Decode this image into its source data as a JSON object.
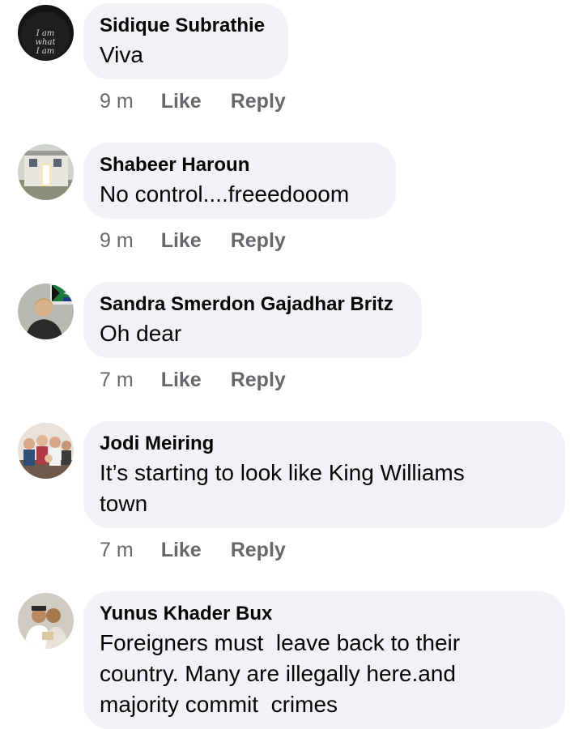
{
  "comments": [
    {
      "author": "Sidique Subrathie",
      "text": "Viva",
      "time": "9 m",
      "like_label": "Like",
      "reply_label": "Reply",
      "avatar": {
        "icon": "profile-photo-text-i-am-what-i-am",
        "caption": "I am what I am"
      }
    },
    {
      "author": "Shabeer Haroun",
      "text": "No control....freeedooom",
      "time": "9 m",
      "like_label": "Like",
      "reply_label": "Reply",
      "avatar": {
        "icon": "profile-photo-house"
      }
    },
    {
      "author": "Sandra Smerdon Gajadhar Britz",
      "text": "Oh dear",
      "time": "7 m",
      "like_label": "Like",
      "reply_label": "Reply",
      "avatar": {
        "icon": "profile-photo-woman-with-sa-flag"
      }
    },
    {
      "author": "Jodi Meiring",
      "text_lines": [
        "It’s starting to look like King Williams",
        "town"
      ],
      "time": "7 m",
      "like_label": "Like",
      "reply_label": "Reply",
      "avatar": {
        "icon": "profile-photo-group"
      }
    },
    {
      "author": "Yunus Khader Bux",
      "text_lines": [
        "Foreigners must  leave back to their",
        "country. Many are illegally here.and",
        "majority commit  crimes"
      ],
      "avatar": {
        "icon": "profile-photo-couple"
      }
    }
  ],
  "colors": {
    "bubble": "#f0f2f5",
    "author": "#050505",
    "meta": "#65676b"
  }
}
